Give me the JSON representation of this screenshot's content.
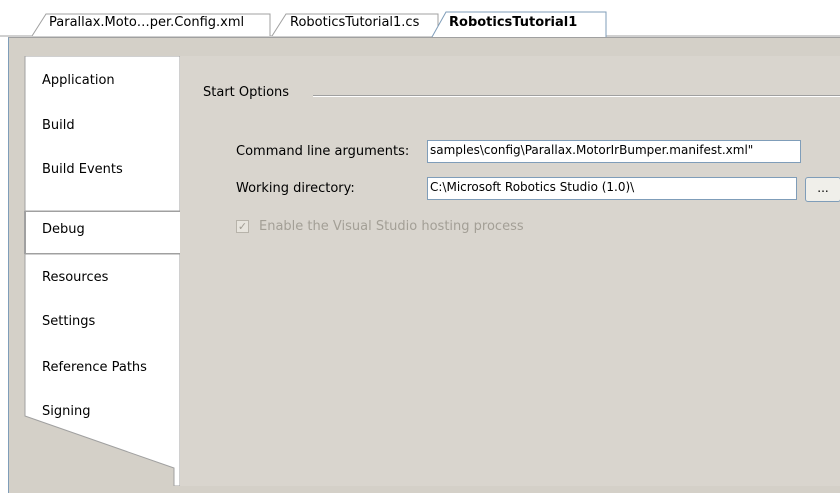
{
  "document_tabs": [
    {
      "label": "Parallax.Moto…per.Config.xml",
      "active": false
    },
    {
      "label": "RoboticsTutorial1.cs",
      "active": false
    },
    {
      "label": "RoboticsTutorial1",
      "active": true
    }
  ],
  "categories": [
    {
      "label": "Application",
      "selected": false
    },
    {
      "label": "Build",
      "selected": false
    },
    {
      "label": "Build Events",
      "selected": false
    },
    {
      "label": "Debug",
      "selected": true
    },
    {
      "label": "Resources",
      "selected": false
    },
    {
      "label": "Settings",
      "selected": false
    },
    {
      "label": "Reference Paths",
      "selected": false
    },
    {
      "label": "Signing",
      "selected": false
    }
  ],
  "start_options": {
    "group_title": "Start Options",
    "command_line_label": "Command line arguments:",
    "command_line_value": "samples\\config\\Parallax.MotorIrBumper.manifest.xml\"",
    "working_dir_label": "Working directory:",
    "working_dir_value": "C:\\Microsoft Robotics Studio (1.0)\\",
    "browse_label": "...",
    "hosting_label": "Enable the Visual Studio hosting process",
    "hosting_checked": true,
    "hosting_enabled": false
  },
  "colors": {
    "panel_bg": "#d4d0c8",
    "border": "#7f9db9",
    "disabled_text": "#a39f96"
  }
}
